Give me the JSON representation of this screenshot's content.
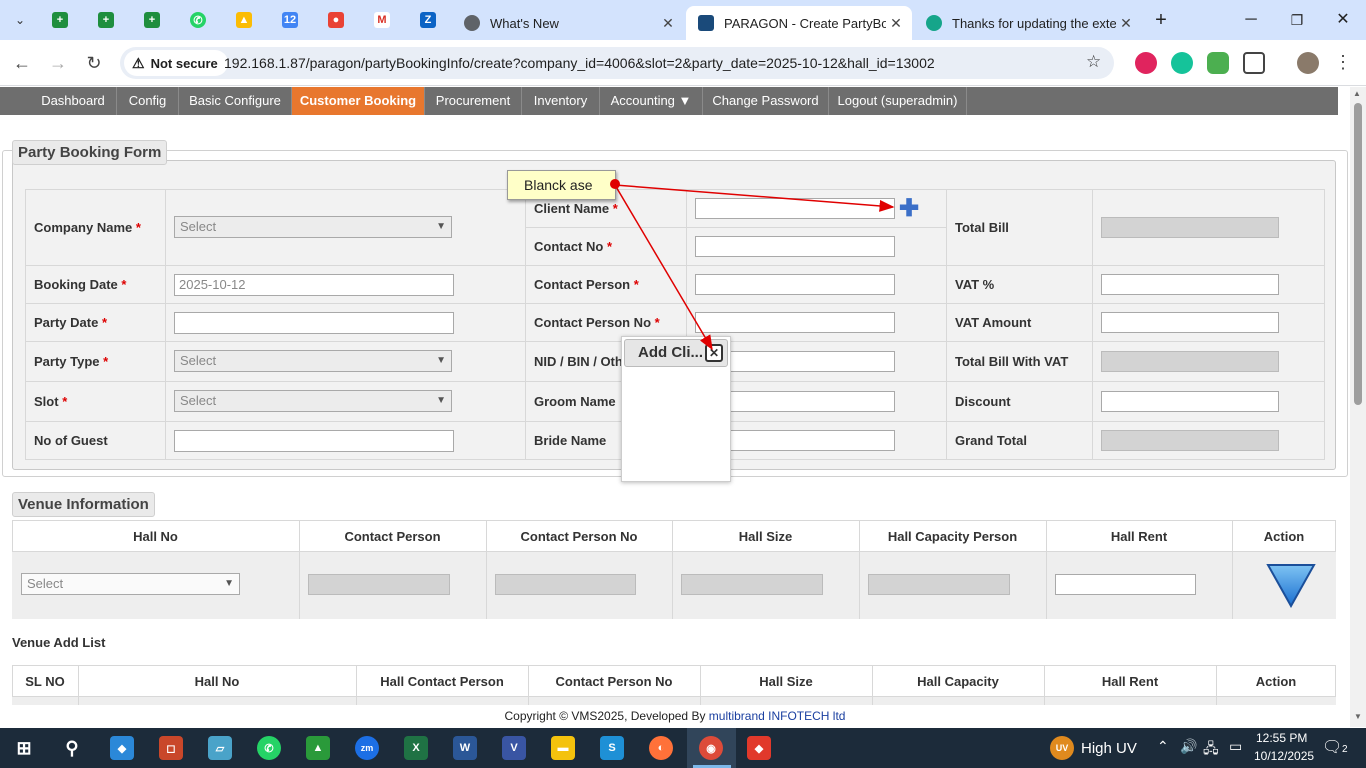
{
  "browser": {
    "tabs": [
      {
        "label": "What's New",
        "active": false
      },
      {
        "label": "PARAGON - Create PartyBookin",
        "active": true
      },
      {
        "label": "Thanks for updating the exte",
        "active": false
      }
    ],
    "security_label": "Not secure",
    "url": "192.168.1.87/paragon/partyBookingInfo/create?company_id=4006&slot=2&party_date=2025-10-12&hall_id=13002"
  },
  "nav": {
    "items": [
      "Dashboard",
      "Config",
      "Basic Configure",
      "Customer Booking",
      "Procurement",
      "Inventory",
      "Accounting ▼",
      "Change Password",
      "Logout (superadmin)"
    ],
    "active": "Customer Booking"
  },
  "form": {
    "legend": "Party Booking Form",
    "left": {
      "company_label": "Company Name",
      "company_value": "Select",
      "booking_date_label": "Booking Date",
      "booking_date_value": "2025-10-12",
      "party_date_label": "Party Date",
      "party_date_value": "",
      "party_type_label": "Party Type",
      "party_type_value": "Select",
      "slot_label": "Slot",
      "slot_value": "Select",
      "guests_label": "No of Guest",
      "guests_value": ""
    },
    "middle": {
      "client_label": "Client Name",
      "contact_label": "Contact No",
      "contact_person_label": "Contact Person",
      "contact_person_no_label": "Contact Person No",
      "nid_label": "NID / BIN / Other",
      "groom_label": "Groom Name",
      "bride_label": "Bride Name"
    },
    "right": {
      "total_bill_label": "Total Bill",
      "vat_label": "VAT %",
      "vat_amount_label": "VAT Amount",
      "total_with_vat_label": "Total Bill With VAT",
      "discount_label": "Discount",
      "grand_total_label": "Grand Total"
    },
    "required_mark": "*"
  },
  "venue": {
    "legend": "Venue Information",
    "columns": [
      "Hall No",
      "Contact Person",
      "Contact Person No",
      "Hall Size",
      "Hall Capacity Person",
      "Hall Rent",
      "Action"
    ],
    "hall_select": "Select"
  },
  "venue_list": {
    "title": "Venue Add List",
    "columns": [
      "SL NO",
      "Hall No",
      "Hall Contact Person",
      "Contact Person No",
      "Hall Size",
      "Hall Capacity",
      "Hall Rent",
      "Action"
    ]
  },
  "popup": {
    "title": "Add Cli...",
    "close_icon": "close-icon"
  },
  "annotation": {
    "text": "Blanck ase",
    "color": "#e00000"
  },
  "footer": {
    "text": "Copyright © VMS2025, Developed By ",
    "link": "multibrand INFOTECH ltd"
  },
  "taskbar": {
    "weather": "High UV",
    "time": "12:55 PM",
    "date": "10/12/2025",
    "notification_count": "2"
  }
}
